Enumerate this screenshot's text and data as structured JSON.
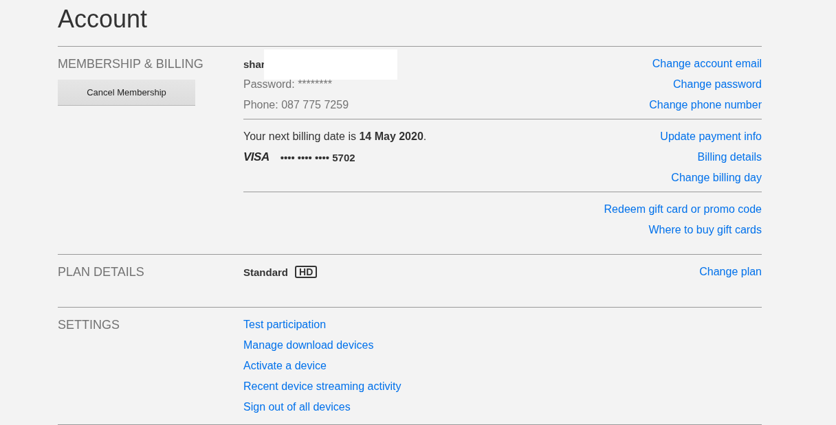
{
  "title": "Account",
  "sections": [
    {
      "kind": "membership",
      "heading": "MEMBERSHIP & BILLING",
      "button": "Cancel Membership",
      "blocks": [
        {
          "info": [
            {
              "kind": "email",
              "text": "shar",
              "redacted": true
            },
            {
              "kind": "password",
              "text": "Password: ********"
            },
            {
              "kind": "phone",
              "text": "Phone: 087 775 7259"
            }
          ],
          "links": [
            "Change account email",
            "Change password",
            "Change phone number"
          ]
        },
        {
          "info": [
            {
              "kind": "billing",
              "text": "Your next billing date is **14 May 2020**."
            },
            {
              "kind": "card",
              "brand": "VISA",
              "text": "•••• •••• •••• 5702"
            }
          ],
          "links": [
            "Update payment info",
            "Billing details",
            "Change billing day"
          ]
        },
        {
          "links": [
            "Redeem gift card or promo code",
            "Where to buy gift cards"
          ]
        }
      ]
    },
    {
      "kind": "plan",
      "heading": "PLAN DETAILS",
      "plan": "Standard",
      "badge": "HD",
      "links": [
        "Change plan"
      ]
    },
    {
      "kind": "settings",
      "heading": "SETTINGS",
      "links": [
        "Test participation",
        "Manage download devices",
        "Activate a device",
        "Recent device streaming activity",
        "Sign out of all devices"
      ]
    }
  ]
}
